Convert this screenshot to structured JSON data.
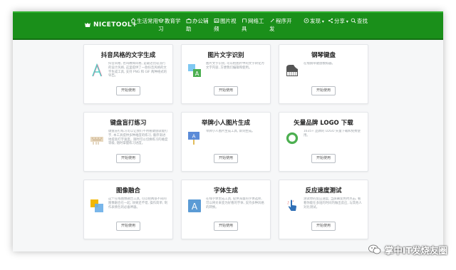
{
  "header": {
    "logo_text": "NICETOOL+",
    "nav": [
      {
        "label": "生活常用",
        "icon": "home-icon"
      },
      {
        "label": "教育学习",
        "icon": "graduation-cap-icon"
      },
      {
        "label": "办公辅助",
        "icon": "briefcase-icon"
      },
      {
        "label": "图片视频",
        "icon": "image-icon"
      },
      {
        "label": "网络工具",
        "icon": "network-icon"
      },
      {
        "label": "程序开发",
        "icon": "code-icon"
      },
      {
        "label": "发现",
        "icon": "compass-icon"
      },
      {
        "label": "分享",
        "icon": "share-icon"
      },
      {
        "label": "查找",
        "icon": "search-icon"
      }
    ]
  },
  "cards": [
    {
      "title": "抖音风格的文字生成",
      "icon": "letter-a-glitch-icon",
      "desc": "抖音风格, 也叫故障风格, 是最近比较流行的设计风格, 这里提供了一款抖音风格的文字生成工具, 支持 PNG 和 GIF 两种格式的导出。",
      "button": "开始使用"
    },
    {
      "title": "图片文字识别",
      "icon": "image-text-ocr-icon",
      "desc": "图片文字识别, 可以把图片中的文字转化为文字内容, 方便我们编辑和使用。",
      "button": "开始使用"
    },
    {
      "title": "钢琴键盘",
      "icon": "piano-icon",
      "desc": "在线钢琴键盘模拟器。",
      "button": "开始使用"
    },
    {
      "title": "键盘盲打练习",
      "icon": "keyboard-typing-icon",
      "desc": "键盘盲打练习可以让我们不用看键盘就能打字, 本工具提供多种难度的练习, 循序渐进地提高打字速度。随时可以切换练习的难度等级, 随时掌握练习进度。",
      "button": "开始使用"
    },
    {
      "title": "举牌小人图片生成",
      "icon": "sign-holder-icon",
      "desc": "举牌小人图片生成工具, 即刻生成。",
      "button": "开始使用"
    },
    {
      "title": "矢量品牌 LOGO 下载",
      "icon": "green-ring-icon",
      "desc": "1635+ 品牌的 LOGO 矢量下载和免费使用。",
      "button": "开始使用"
    },
    {
      "title": "图像融合",
      "icon": "overlapping-squares-icon",
      "desc": "这个在线图像融合工具, 可以把两张不同的图像融合在一起, 效果还不错, 操作简单, 制作表情包的必备神器。",
      "button": "开始使用"
    },
    {
      "title": "字体生成",
      "icon": "letter-a-tile-icon",
      "desc": "在线字体生成工具, 提供海量的字体选择, 可以将文本变为好看的字体, 支持多种风格的转换。",
      "button": "开始使用"
    },
    {
      "title": "反应速度测试",
      "icon": "tap-pointer-icon",
      "desc": "测试你的反应速度, 当屏幕变色时点击, 看看你能在多短的时间内做出反应, 与其他人对比测试。",
      "button": "开始使用"
    }
  ],
  "watermark": {
    "text": "掌中IT发烧友圈",
    "icon": "wechat-icon"
  },
  "colors": {
    "header_green": "#1a8f1a",
    "page_bg": "#f6f7f8",
    "accent_green": "#4caf50"
  }
}
